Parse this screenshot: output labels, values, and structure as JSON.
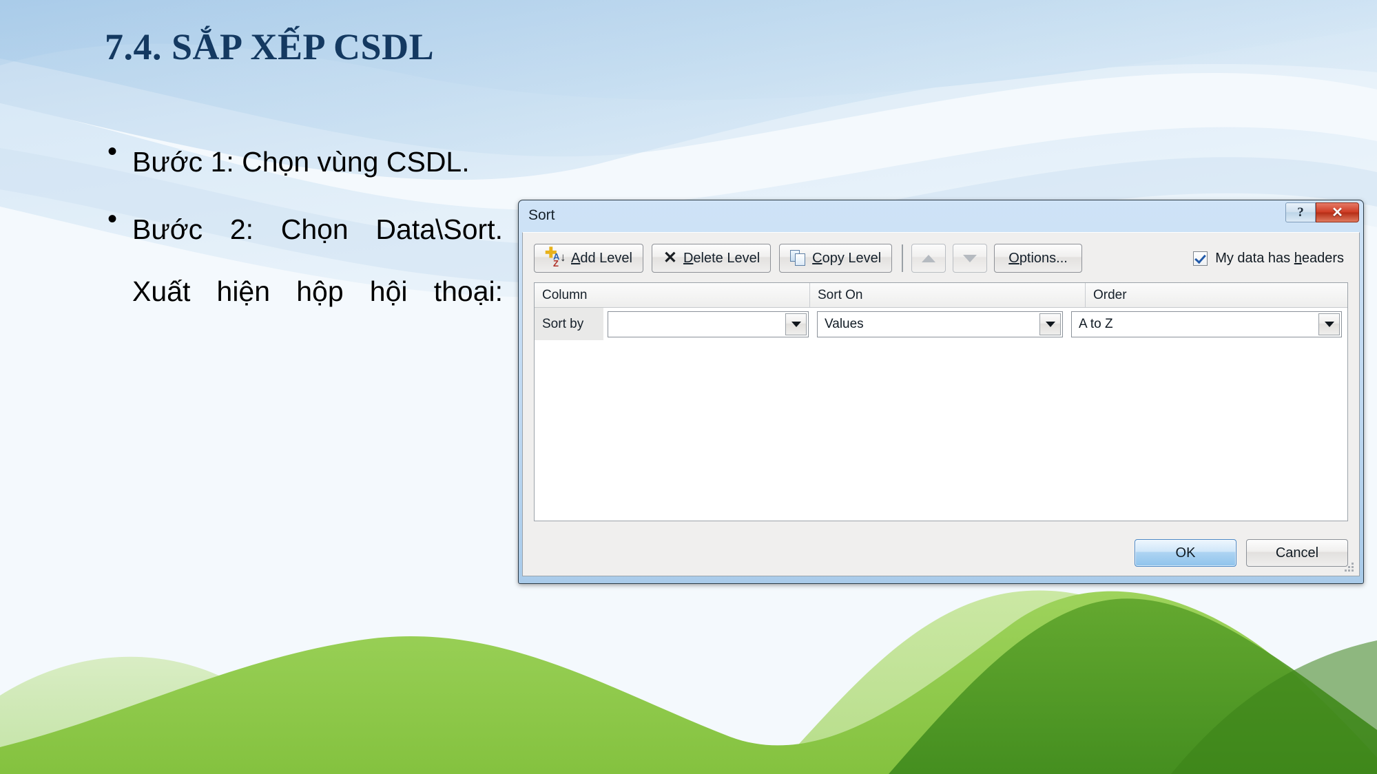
{
  "slide": {
    "title": "7.4. SẮP XẾP CSDL",
    "title_color": "#143961",
    "background_color": "#f3f8fc",
    "bullets": [
      {
        "marker": "•",
        "text": "Bước 1: Chọn vùng CSDL."
      },
      {
        "marker": "•",
        "text": "Bước 2: Chọn Data\\Sort. Xuất hiện hộp hội thoại:"
      }
    ]
  },
  "dialog": {
    "title": "Sort",
    "caption_buttons": {
      "help": "?",
      "close": "✕"
    },
    "toolbar": {
      "add_level": {
        "label_pre": "",
        "accel": "A",
        "label_post": "dd Level"
      },
      "delete_level": {
        "label_pre": "",
        "accel": "D",
        "label_post": "elete Level"
      },
      "copy_level": {
        "label_pre": "",
        "accel": "C",
        "label_post": "opy Level"
      },
      "move_up": "▲",
      "move_down": "▼",
      "options": {
        "label_pre": "",
        "accel": "O",
        "label_post": "ptions..."
      },
      "my_data_has_headers": {
        "label_pre": "My data has ",
        "accel": "h",
        "label_post": "eaders"
      },
      "headers_checked": true
    },
    "grid": {
      "headers": [
        "Column",
        "Sort On",
        "Order"
      ],
      "rows": [
        {
          "level_label": "Sort by",
          "column_value": "",
          "sort_on_value": "Values",
          "order_value": "A to Z"
        }
      ]
    },
    "footer": {
      "ok": "OK",
      "cancel": "Cancel"
    }
  }
}
